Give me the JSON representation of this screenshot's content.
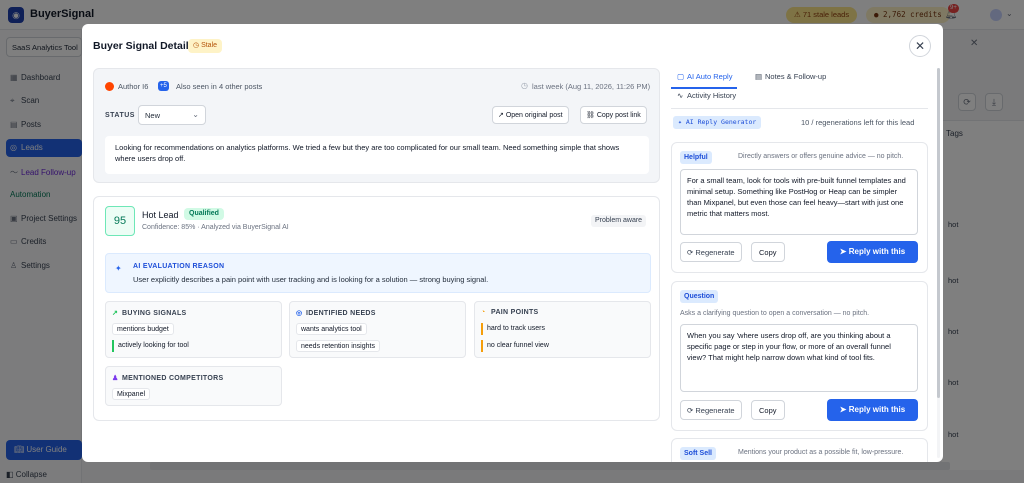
{
  "app": {
    "brand": "BuyerSignal",
    "stale_leads": "71 stale leads",
    "credits": "2,762 credits",
    "notifications": "9+",
    "workspace": "SaaS Analytics Tool"
  },
  "sidebar": {
    "items": [
      {
        "icon": "grid-icon",
        "label": "Dashboard"
      },
      {
        "icon": "scan-icon",
        "label": "Scan"
      },
      {
        "icon": "document-icon",
        "label": "Posts"
      },
      {
        "icon": "leads-icon",
        "label": "Leads"
      },
      {
        "icon": "followup-icon",
        "label": "Lead Follow-up"
      },
      {
        "icon": "",
        "label": "Automation"
      },
      {
        "icon": "settings-icon",
        "label": "Project Settings"
      },
      {
        "icon": "credits-icon",
        "label": "Credits"
      },
      {
        "icon": "user-icon",
        "label": "Settings"
      }
    ],
    "user_guide": "User Guide",
    "collapse": "Collapse"
  },
  "background": {
    "tags_header": "Tags",
    "hot_tag": "hot"
  },
  "modal": {
    "title": "Buyer Signal Detail",
    "stale_badge": "Stale",
    "post": {
      "author": "Author I6",
      "seen_count": "+5",
      "seen_text": "Also seen in 4 other posts",
      "time": "last week (Aug 11, 2026, 11:26 PM)",
      "status_label": "STATUS",
      "status_value": "New",
      "open_original": "Open original post",
      "copy_link": "Copy post link",
      "text": "Looking for recommendations on analytics platforms. We tried a few but they are too complicated for our small team. Need something simple that shows where users drop off."
    },
    "analysis": {
      "score": "95",
      "lead_type": "Hot Lead",
      "qualified": "Qualified",
      "confidence": "Confidence: 85% · Analyzed via BuyerSignal AI",
      "stage": "Problem aware",
      "eval_title": "AI EVALUATION REASON",
      "eval_text": "User explicitly describes a pain point with user tracking and is looking for a solution — strong buying signal.",
      "buying_signals_title": "BUYING SIGNALS",
      "buying_signals": [
        "mentions budget",
        "actively looking for tool"
      ],
      "needs_title": "IDENTIFIED NEEDS",
      "needs": [
        "wants analytics tool",
        "needs retention insights"
      ],
      "pain_title": "PAIN POINTS",
      "pain": [
        "hard to track users",
        "no clear funnel view"
      ],
      "competitors_title": "MENTIONED COMPETITORS",
      "competitors": [
        "Mixpanel"
      ]
    },
    "panel": {
      "tabs": [
        "AI Auto Reply",
        "Notes & Follow-up",
        "Activity History"
      ],
      "generator": "AI Reply Generator",
      "regen_left": "10 / regenerations left for this lead",
      "regenerate": "Regenerate",
      "copy": "Copy",
      "reply": "Reply with this",
      "replies": [
        {
          "badge": "Helpful",
          "desc": "Directly answers or offers genuine advice — no pitch.",
          "text": "For a small team, look for tools with pre-built funnel templates and minimal setup. Something like PostHog or Heap can be simpler than Mixpanel, but even those can feel heavy—start with just one metric that matters most."
        },
        {
          "badge": "Question",
          "desc": "Asks a clarifying question to open a conversation — no pitch.",
          "text": "When you say 'where users drop off, are you thinking about a specific page or step in your flow, or more of an overall funnel view? That might help narrow down what kind of tool fits."
        },
        {
          "badge": "Soft Sell",
          "desc": "Mentions your product as a possible fit, low-pressure."
        }
      ]
    }
  }
}
